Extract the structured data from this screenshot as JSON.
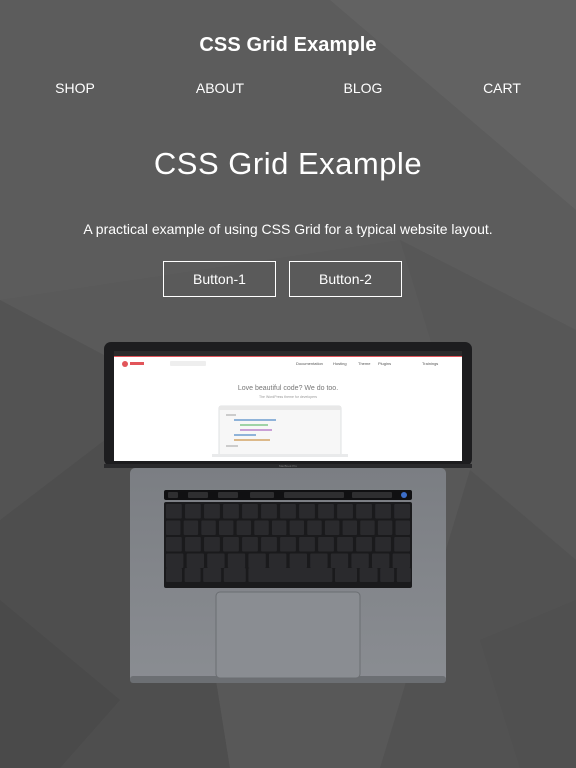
{
  "header": {
    "title": "CSS Grid Example",
    "nav": [
      "SHOP",
      "ABOUT",
      "BLOG",
      "CART"
    ]
  },
  "hero": {
    "title": "CSS Grid Example",
    "text": "A practical example of using CSS Grid for a typical website layout.",
    "buttons": [
      "Button-1",
      "Button-2"
    ]
  },
  "laptop": {
    "screen_nav": [
      "Documentation",
      "Hosting",
      "Theme",
      "Plugins",
      "Trainings"
    ],
    "screen_headline": "Love beautiful code? We do too.",
    "screen_subline": "The WordPress theme for developers",
    "bezel_label": "MacBook Pro"
  },
  "colors": {
    "background": "#5a5a5a",
    "text": "#ffffff",
    "screen_accent": "#e2555a"
  }
}
